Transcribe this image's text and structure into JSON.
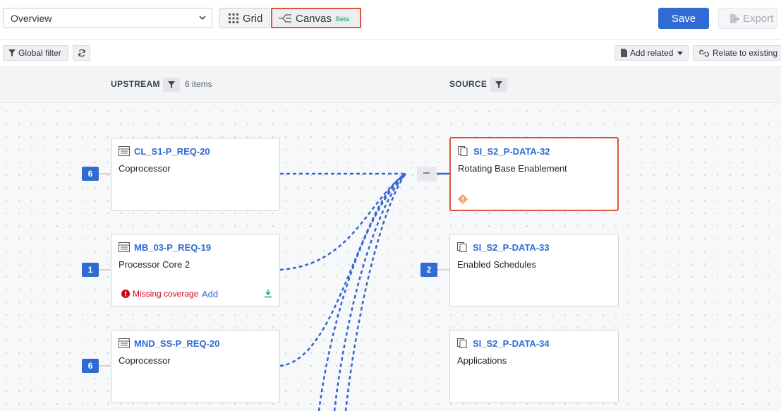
{
  "toolbar": {
    "view_select_value": "Overview",
    "grid_label": "Grid",
    "canvas_label": "Canvas",
    "canvas_badge": "Beta",
    "save_label": "Save",
    "export_label": "Export"
  },
  "subtoolbar": {
    "global_filter_label": "Global filter",
    "add_related_label": "Add related",
    "relate_existing_label": "Relate to existing"
  },
  "columns": {
    "upstream": {
      "title": "UPSTREAM",
      "count": "6 items"
    },
    "source": {
      "title": "SOURCE"
    }
  },
  "upstream_items": [
    {
      "id": "CL_S1-P_REQ-20",
      "title": "Coprocessor",
      "count": "6"
    },
    {
      "id": "MB_03-P_REQ-19",
      "title": "Processor Core 2",
      "count": "1",
      "warning": "Missing coverage",
      "action": "Add"
    },
    {
      "id": "MND_SS-P_REQ-20",
      "title": "Coprocessor",
      "count": "6"
    }
  ],
  "source_items": [
    {
      "id": "SI_S2_P-DATA-32",
      "title": "Rotating Base Enablement"
    },
    {
      "id": "SI_S2_P-DATA-33",
      "title": "Enabled Schedules",
      "count": "2"
    },
    {
      "id": "SI_S2_P-DATA-34",
      "title": "Applications"
    }
  ],
  "collapse_symbol": "–",
  "colors": {
    "accent": "#2f6bd3",
    "highlight": "#d9553b",
    "error": "#d0021b",
    "link_line": "#3366cc"
  }
}
